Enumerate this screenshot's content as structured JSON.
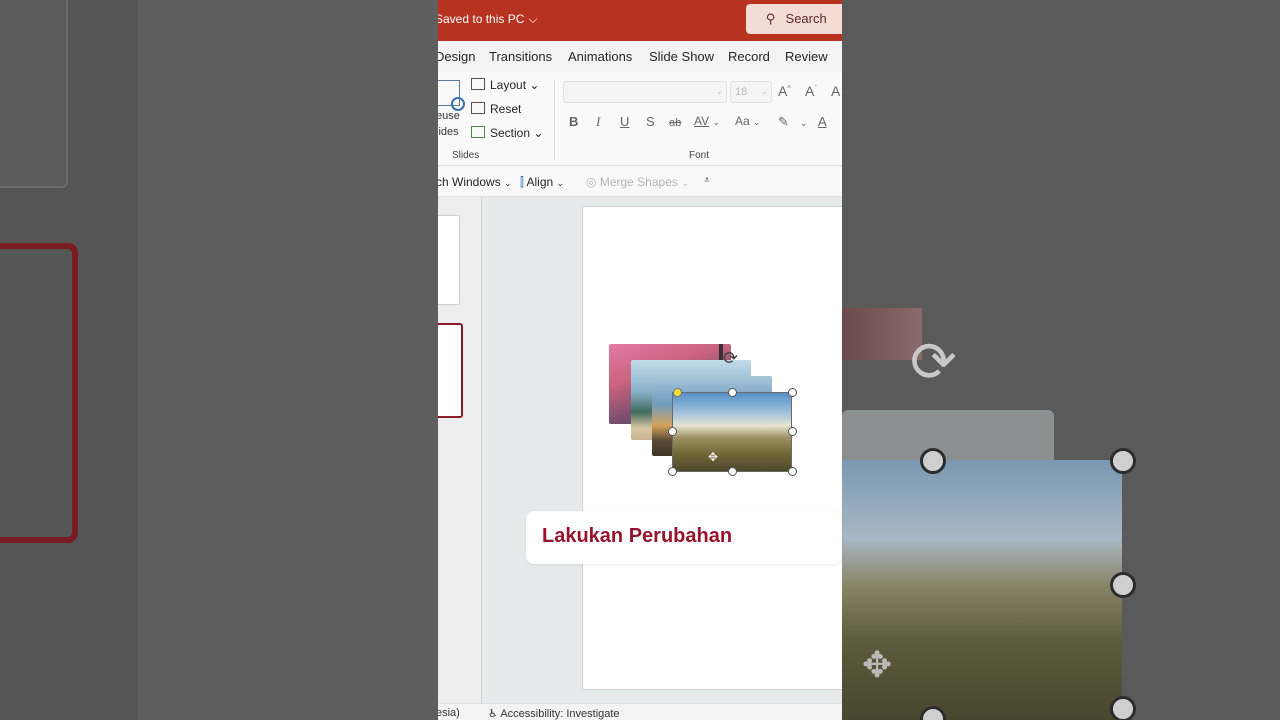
{
  "titlebar": {
    "saved_status": "Saved to this PC",
    "search_label": "Search"
  },
  "tabs": [
    "Design",
    "Transitions",
    "Animations",
    "Slide Show",
    "Record",
    "Review"
  ],
  "ribbon": {
    "reuse_line1": "euse",
    "reuse_line2": "lides",
    "layout": "Layout",
    "reset": "Reset",
    "section": "Section",
    "slides_group": "Slides",
    "font_size": "18",
    "bold": "B",
    "italic": "I",
    "underline": "U",
    "shadow": "S",
    "strike": "ab",
    "spacing": "AV",
    "case": "Aa",
    "font_group": "Font"
  },
  "quick_toolbar": {
    "switch_windows": "ch Windows",
    "align": "Align",
    "merge_shapes": "Merge Shapes"
  },
  "statusbar": {
    "language": "esia)",
    "accessibility": "Accessibility: Investigate"
  },
  "callout": {
    "text": "Lakukan Perubahan"
  },
  "colors": {
    "titlebar": "#b7321f",
    "accent": "#96142e"
  }
}
